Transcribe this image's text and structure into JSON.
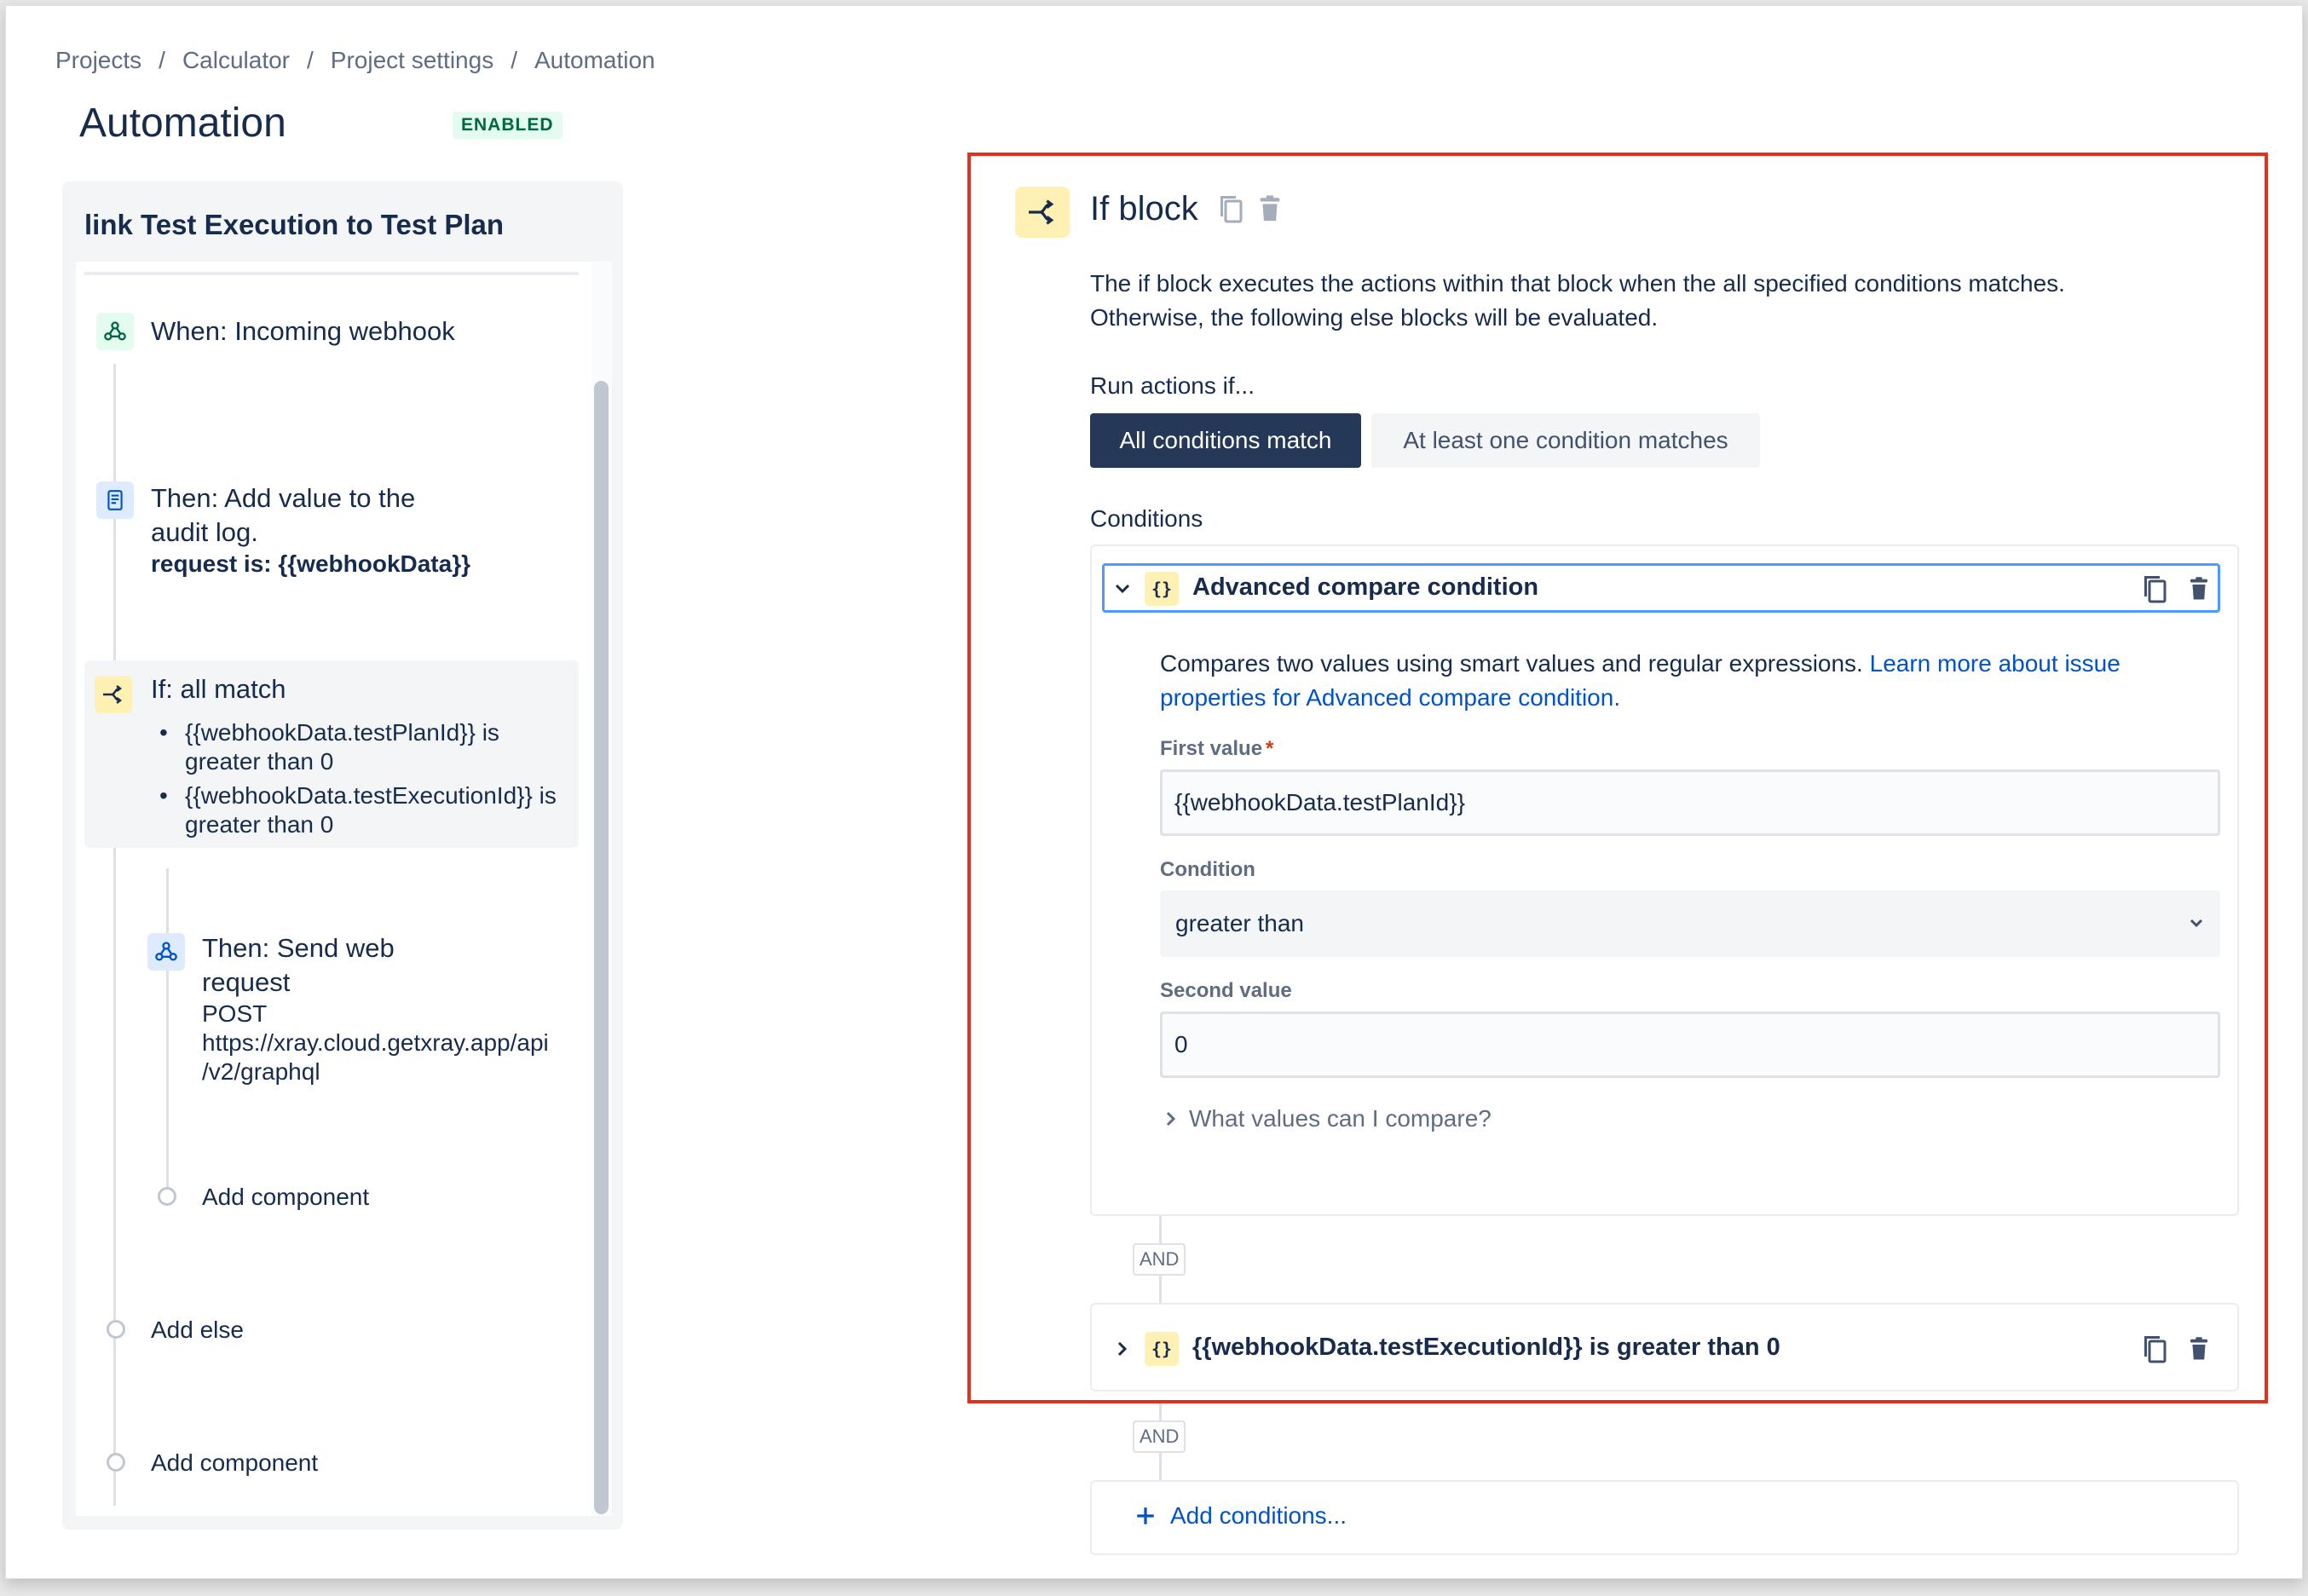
{
  "breadcrumb": {
    "items": [
      "Projects",
      "Calculator",
      "Project settings",
      "Automation"
    ],
    "separator": "/"
  },
  "page": {
    "title": "Automation",
    "status": "ENABLED"
  },
  "rule": {
    "name": "link Test Execution to Test Plan",
    "trigger": {
      "label": "When: Incoming webhook",
      "icon": "webhook-icon"
    },
    "action_log": {
      "label_line1": "Then: Add value to the",
      "label_line2": "audit log.",
      "detail": "request is: {{webhookData}}",
      "icon": "audit-log-icon"
    },
    "if_block": {
      "label": "If: all match",
      "icon": "branch-icon",
      "conditions": [
        {
          "line1": "{{webhookData.testPlanId}} is",
          "line2": "greater than 0"
        },
        {
          "line1": "{{webhookData.testExecutionId}} is",
          "line2": "greater than 0"
        }
      ]
    },
    "web_request": {
      "label_line1": "Then: Send web",
      "label_line2": "request",
      "method": "POST",
      "url_line1": "https://xray.cloud.getxray.app/api",
      "url_line2": "/v2/graphql",
      "icon": "webhook-icon"
    },
    "add_component_inner": "Add component",
    "add_else": "Add else",
    "add_component_outer": "Add component"
  },
  "detail": {
    "title": "If block",
    "description_line1": "The if block executes the actions within that block when the all specified conditions matches.",
    "description_line2": "Otherwise, the following else blocks will be evaluated.",
    "run_actions_label": "Run actions if...",
    "mode_all": "All conditions match",
    "mode_any": "At least one condition matches",
    "conditions_label": "Conditions",
    "condition1": {
      "title": "Advanced compare condition",
      "desc_text": "Compares two values using smart values and regular expressions. ",
      "desc_link_line1": "Learn more about issue",
      "desc_link_line2": "properties for Advanced compare condition.",
      "first_value_label": "First value",
      "first_value": "{{webhookData.testPlanId}}",
      "condition_label": "Condition",
      "condition_value": "greater than",
      "second_value_label": "Second value",
      "second_value": "0",
      "help_expander": "What values can I compare?"
    },
    "and_label_1": "AND",
    "condition2": {
      "title": "{{webhookData.testExecutionId}} is greater than 0"
    },
    "and_label_2": "AND",
    "add_conditions": "Add conditions..."
  },
  "colors": {
    "highlight": "#e0301e",
    "primary_dark": "#253858",
    "link": "#0052cc",
    "focus": "#4c9aff"
  }
}
